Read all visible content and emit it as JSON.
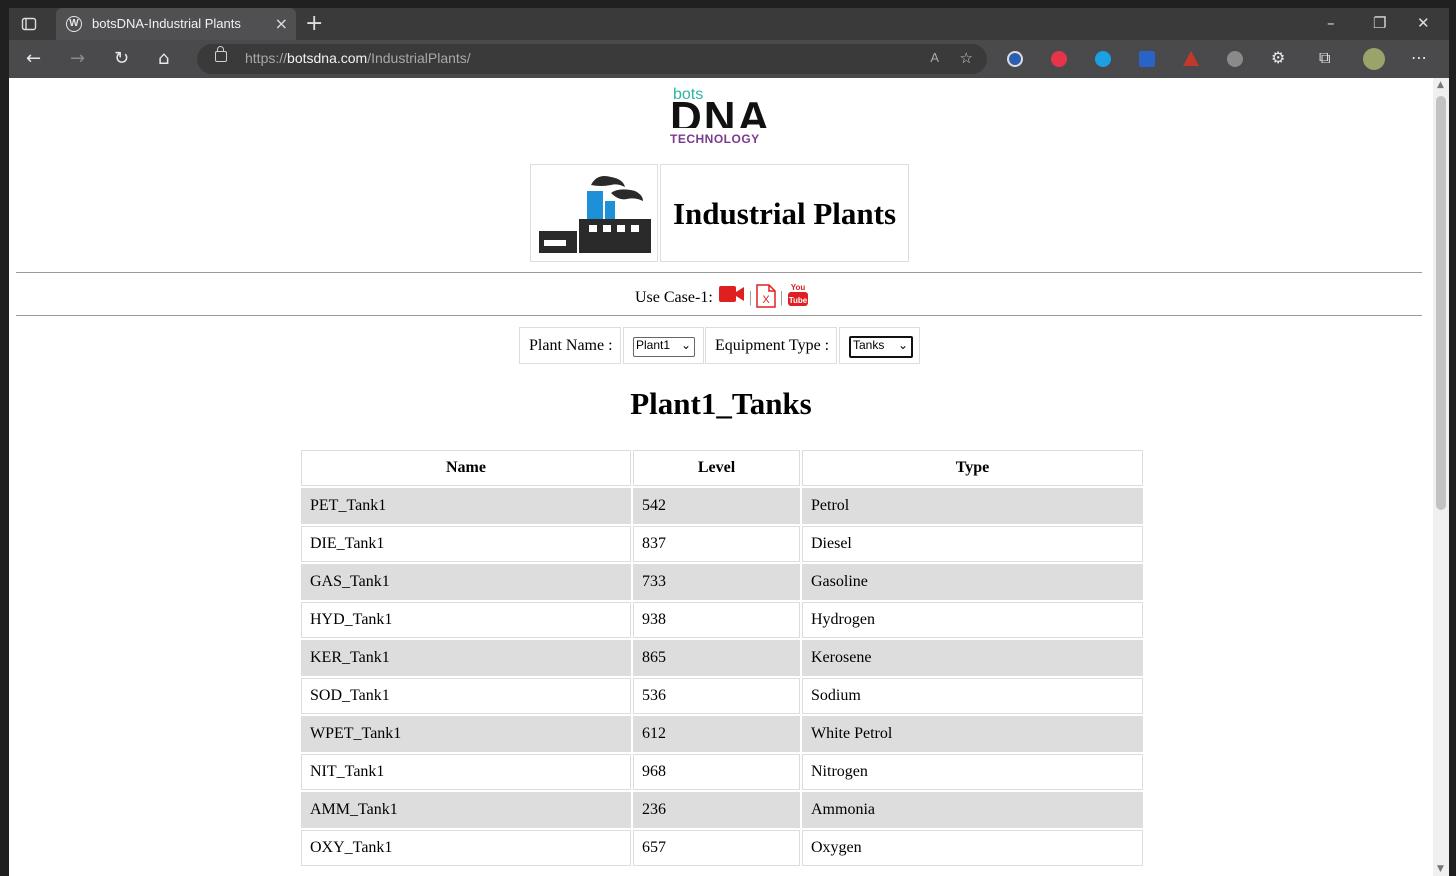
{
  "browser": {
    "tab_title": "botsDNA-Industrial Plants",
    "url_prefix": "https://",
    "url_host": "botsdna.com",
    "url_path": "/IndustrialPlants/",
    "read_aloud": "A"
  },
  "logo": {
    "top": "bots",
    "main": "DNA",
    "bottom": "TECHNOLOGY"
  },
  "page_title": "Industrial Plants",
  "use_case": {
    "label": "Use Case-1:"
  },
  "filters": {
    "plant_label": "Plant Name :",
    "plant_value": "Plant1",
    "equipment_label": "Equipment Type :",
    "equipment_value": "Tanks"
  },
  "table_heading": "Plant1_Tanks",
  "table": {
    "columns": [
      "Name",
      "Level",
      "Type"
    ],
    "rows": [
      [
        "PET_Tank1",
        "542",
        "Petrol"
      ],
      [
        "DIE_Tank1",
        "837",
        "Diesel"
      ],
      [
        "GAS_Tank1",
        "733",
        "Gasoline"
      ],
      [
        "HYD_Tank1",
        "938",
        "Hydrogen"
      ],
      [
        "KER_Tank1",
        "865",
        "Kerosene"
      ],
      [
        "SOD_Tank1",
        "536",
        "Sodium"
      ],
      [
        "WPET_Tank1",
        "612",
        "White Petrol"
      ],
      [
        "NIT_Tank1",
        "968",
        "Nitrogen"
      ],
      [
        "AMM_Tank1",
        "236",
        "Ammonia"
      ],
      [
        "OXY_Tank1",
        "657",
        "Oxygen"
      ]
    ]
  },
  "colors": {
    "accent_red": "#e02020",
    "logo_teal": "#2bb6a0",
    "logo_purple": "#7b3a8e",
    "row_alt": "#dddddd"
  }
}
